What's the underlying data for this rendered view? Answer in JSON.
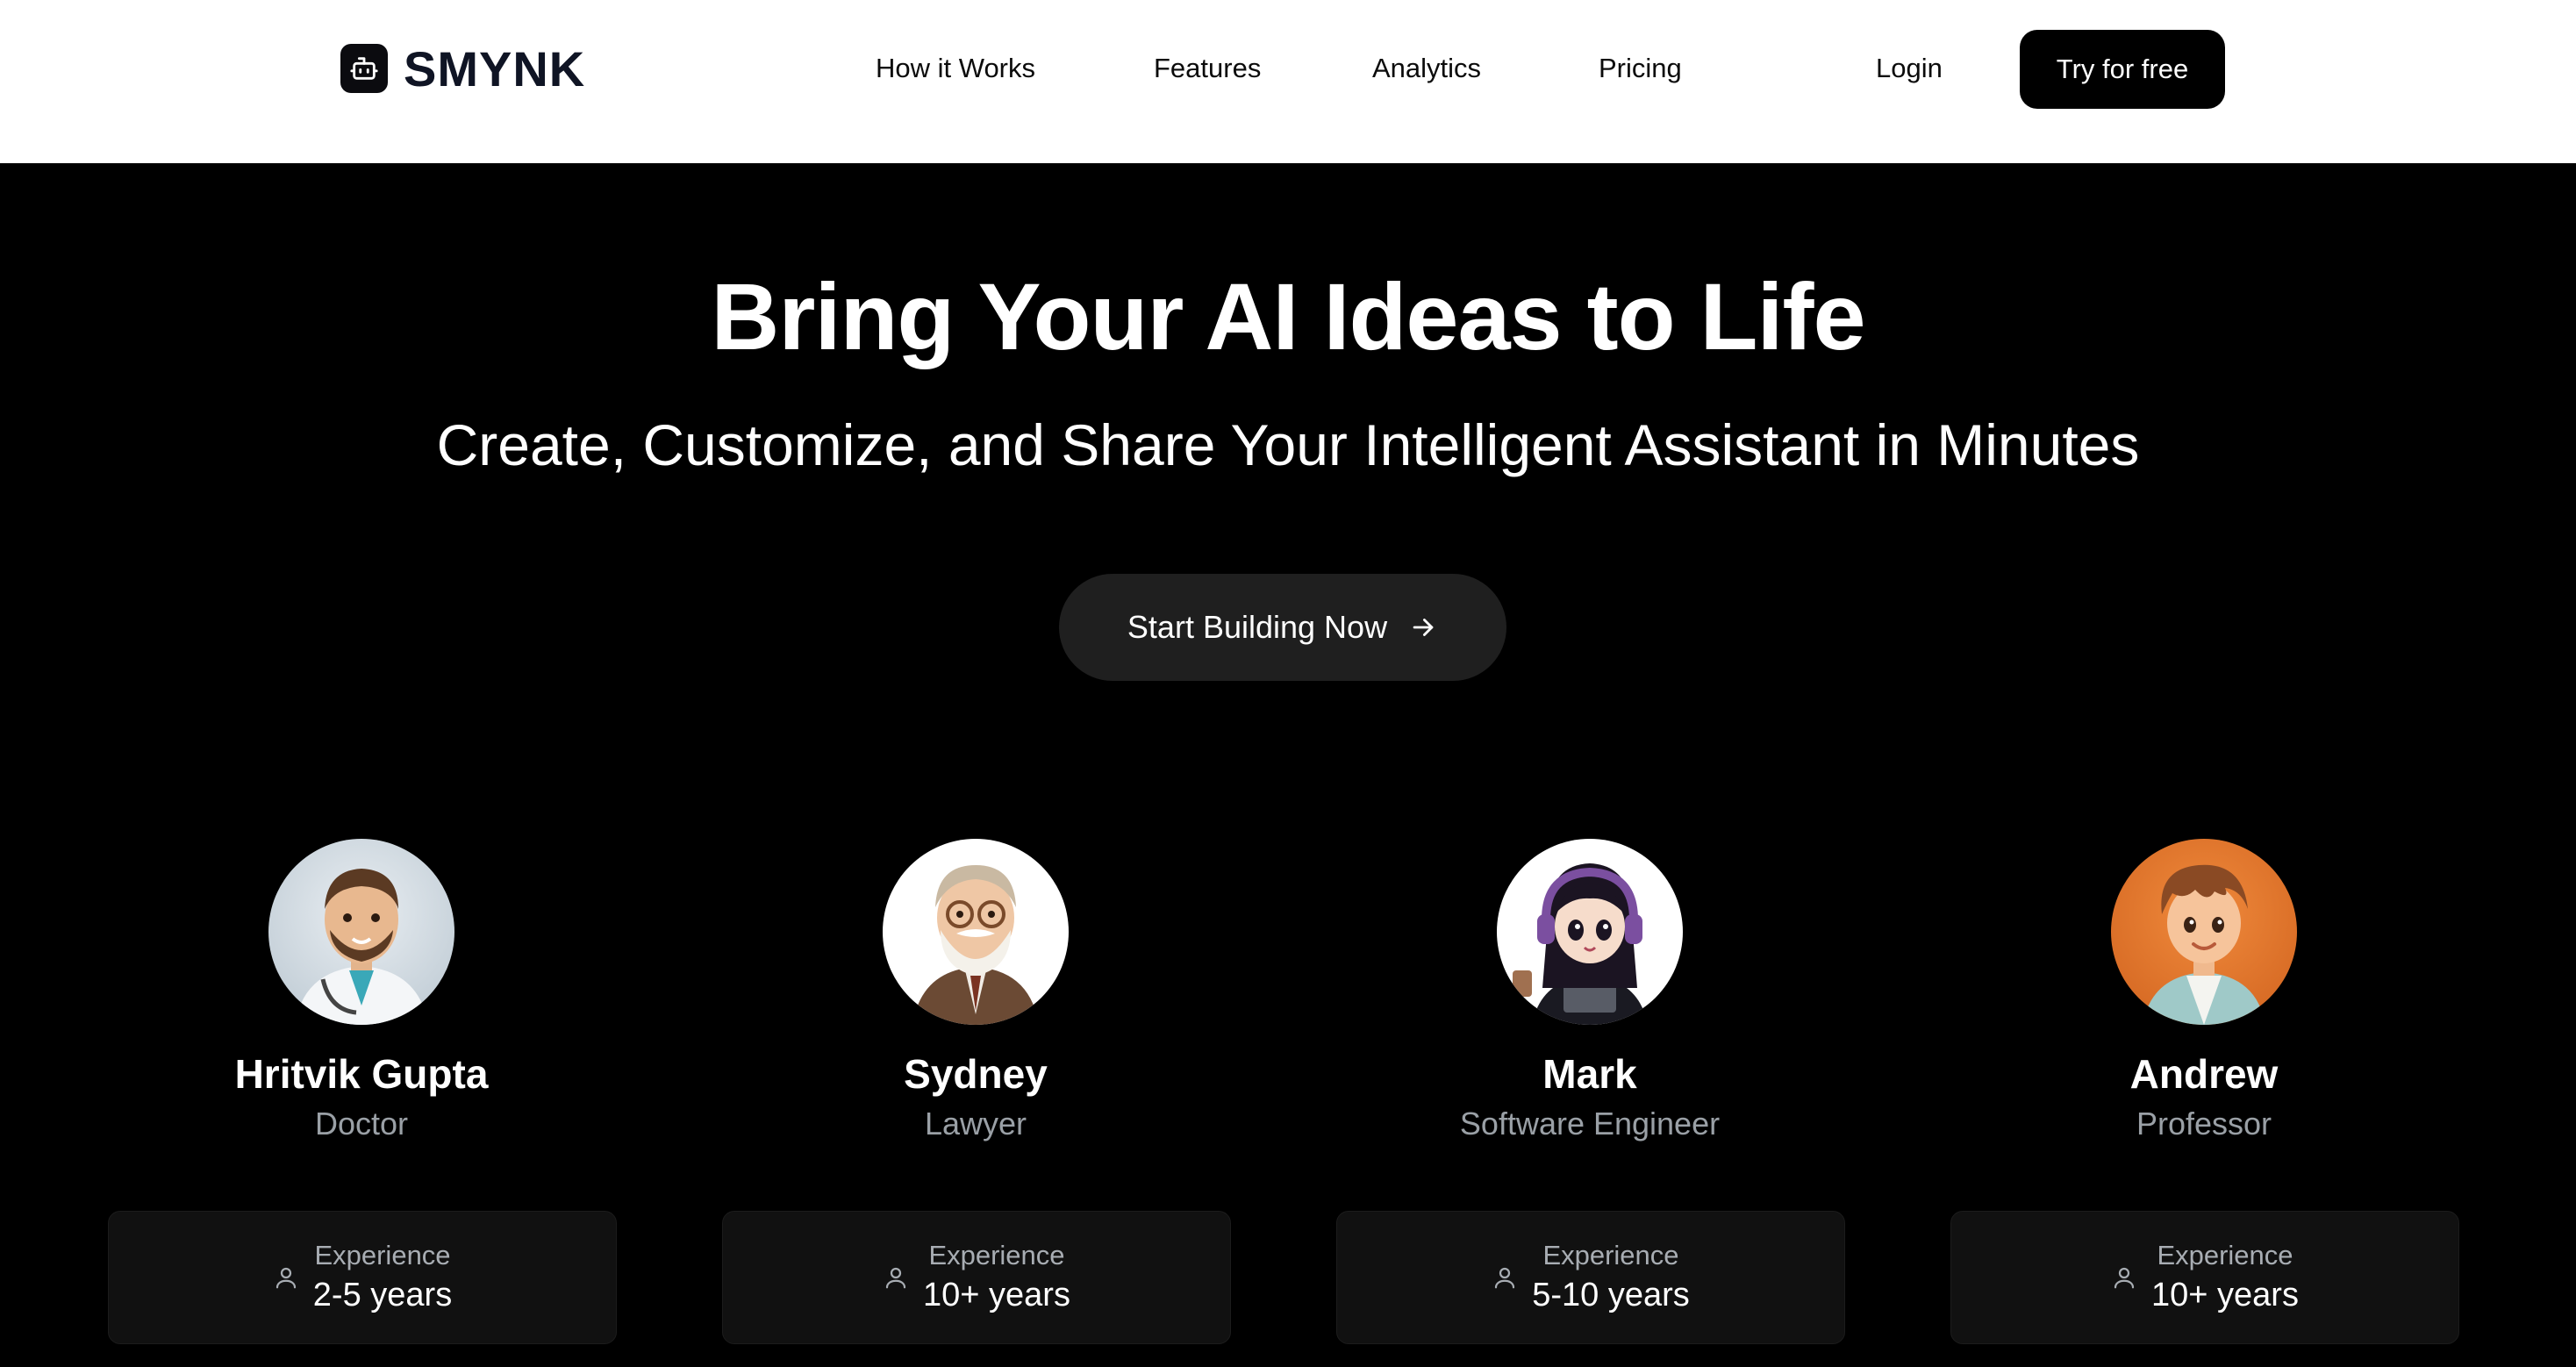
{
  "header": {
    "brand": "SMYNK",
    "nav": [
      "How it Works",
      "Features",
      "Analytics",
      "Pricing"
    ],
    "login": "Login",
    "cta": "Try for free"
  },
  "hero": {
    "title": "Bring Your AI Ideas to Life",
    "subtitle": "Create, Customize, and Share Your Intelligent Assistant in Minutes",
    "button": "Start Building Now"
  },
  "assistants": [
    {
      "name": "Hritvik Gupta",
      "role": "Doctor",
      "experience_label": "Experience",
      "experience": "2-5 years"
    },
    {
      "name": "Sydney",
      "role": "Lawyer",
      "experience_label": "Experience",
      "experience": "10+ years"
    },
    {
      "name": "Mark",
      "role": "Software Engineer",
      "experience_label": "Experience",
      "experience": "5-10 years"
    },
    {
      "name": "Andrew",
      "role": "Professor",
      "experience_label": "Experience",
      "experience": "10+ years"
    }
  ],
  "colors": {
    "background": "#000000",
    "header": "#ffffff",
    "button_dark": "#1f1f1f",
    "card": "#111111",
    "muted_text": "#9aa0a6"
  },
  "icons": [
    "bot-logo-icon",
    "arrow-right-icon",
    "user-icon"
  ]
}
